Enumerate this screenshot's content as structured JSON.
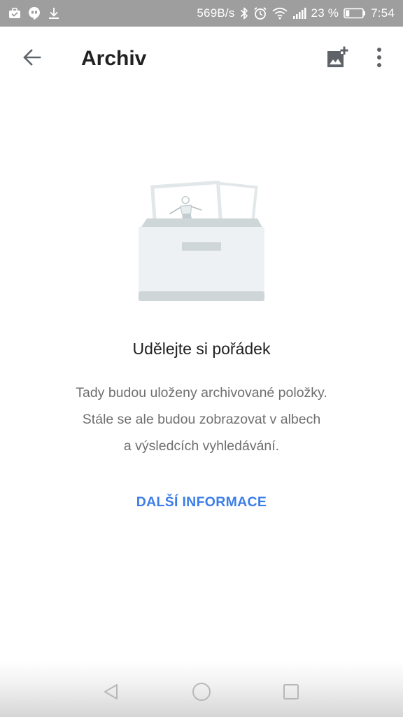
{
  "status_bar": {
    "net_speed": "569B/s",
    "battery_percent": "23 %",
    "battery_level": 0.23,
    "time": "7:54",
    "left_icons": [
      "briefcase-icon",
      "hangouts-icon",
      "download-icon"
    ],
    "right_icons": [
      "bluetooth-icon",
      "alarm-icon",
      "wifi-icon",
      "signal-icon",
      "battery-icon"
    ]
  },
  "app_bar": {
    "title": "Archiv",
    "icons": [
      "arrow-back-icon",
      "add-photo-icon",
      "more-vert-icon"
    ]
  },
  "empty_state": {
    "title": "Udělejte si pořádek",
    "body_lines": [
      "Tady budou uloženy archivované položky.",
      "Stále se ale budou zobrazovat v albech",
      "a výsledcích vyhledávání."
    ],
    "link_label": "DALŠÍ INFORMACE",
    "illustration": "archive-box-illustration"
  },
  "nav_bar": {
    "icons": [
      "nav-back-icon",
      "nav-home-icon",
      "nav-recents-icon"
    ]
  },
  "colors": {
    "status_bar_bg": "#9e9e9e",
    "link": "#3c7ee8",
    "title_text": "#212121",
    "body_text": "#6f6f6f",
    "illustration_gray": "#cfd6d8",
    "illustration_light": "#eef1f3"
  }
}
